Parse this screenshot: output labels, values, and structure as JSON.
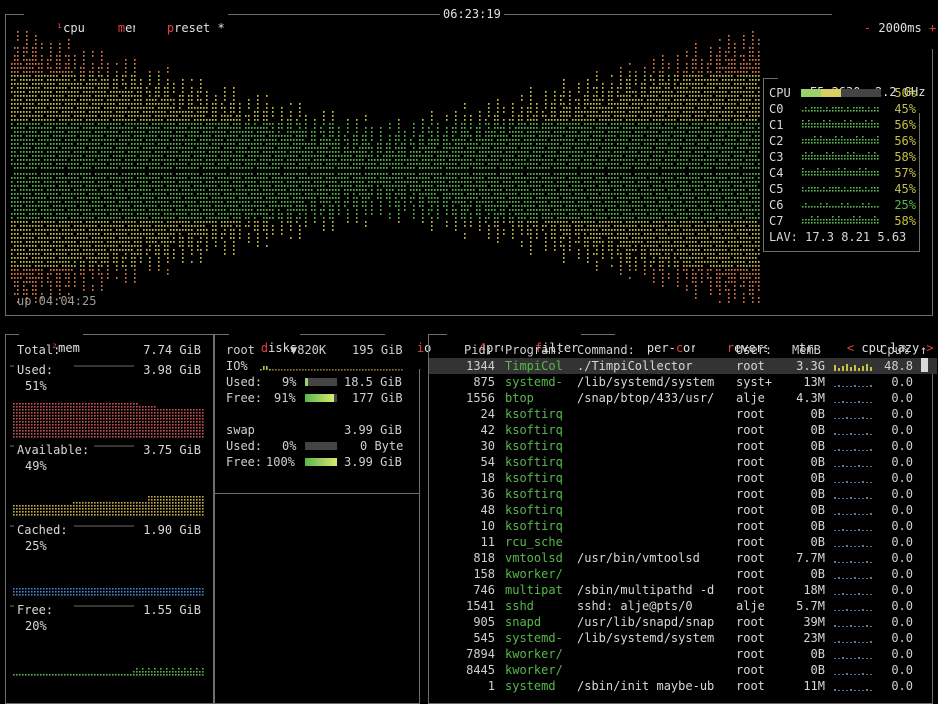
{
  "cpu_box": {
    "title_sup": "¹",
    "title_cpu": "cpu",
    "menu_hot": "m",
    "menu_rest": "enu",
    "preset_hot": "p",
    "preset_rest": "reset *",
    "clock": "06:23:19",
    "minus": "-",
    "interval": "2000ms",
    "plus": "+",
    "uptime": "up 04:04:25",
    "model": "E5-2630",
    "freq": "2.2 GHz",
    "total_label": "CPU",
    "total_percent": "50%",
    "total_level": 0.5,
    "cores": [
      {
        "label": "C0",
        "percent": "45%"
      },
      {
        "label": "C1",
        "percent": "56%"
      },
      {
        "label": "C2",
        "percent": "56%"
      },
      {
        "label": "C3",
        "percent": "58%"
      },
      {
        "label": "C4",
        "percent": "57%"
      },
      {
        "label": "C5",
        "percent": "45%"
      },
      {
        "label": "C6",
        "percent": "25%"
      },
      {
        "label": "C7",
        "percent": "58%"
      }
    ],
    "load_avg": "LAV: 17.3 8.21 5.63"
  },
  "mem_box": {
    "title_sup": "²",
    "title": "mem",
    "total_label": "Total:",
    "total_value": "7.74 GiB",
    "used_label": "Used:",
    "used_value": "3.98 GiB",
    "used_percent": "51%",
    "available_label": "Available:",
    "available_value": "3.75 GiB",
    "available_percent": "49%",
    "cached_label": "Cached:",
    "cached_value": "1.90 GiB",
    "cached_percent": "25%",
    "free_label": "Free:",
    "free_value": "1.55 GiB",
    "free_percent": "20%"
  },
  "disks_box": {
    "title_hot": "d",
    "title_rest": "isks",
    "io_hot": "i",
    "io_rest": "o",
    "root_name": "root",
    "root_io": "▼820K",
    "root_size": "195 GiB",
    "io_label": "IO%",
    "root_used_label": "Used:",
    "root_used_pct": "9%",
    "root_used_level": 0.09,
    "root_used_value": "18.5 GiB",
    "root_free_label": "Free:",
    "root_free_pct": "91%",
    "root_free_level": 0.91,
    "root_free_value": "177 GiB",
    "swap_name": "swap",
    "swap_size": "3.99 GiB",
    "swap_used_label": "Used:",
    "swap_used_pct": "0%",
    "swap_used_level": 0.0,
    "swap_used_value": "0 Byte",
    "swap_free_label": "Free:",
    "swap_free_pct": "100%",
    "swap_free_level": 1.0,
    "swap_free_value": "3.99 GiB"
  },
  "proc_box": {
    "title_sup": "4",
    "title": "proc",
    "filter_hot": "f",
    "filter_rest": "ilter",
    "percore_a": "per-",
    "percore_hot": "c",
    "percore_b": "ore",
    "reverse_hot": "r",
    "reverse_rest": "everse",
    "tree_a": "tr",
    "tree_hot": "e",
    "tree_b": "e",
    "left_arrow": "<",
    "sort_label": "cpu lazy",
    "right_arrow": ">",
    "headers": {
      "pid": "Pid:",
      "program": "Program:",
      "command": "Command:",
      "user": "User:",
      "mem": "MemB",
      "cpu": "Cpu%"
    },
    "scroll_up": "↑",
    "rows": [
      {
        "pid": "1344",
        "program": "TimpiCol",
        "command": "./TimpiCollector",
        "user": "root",
        "mem": "3.3G",
        "cpu": "48.8"
      },
      {
        "pid": "875",
        "program": "systemd-",
        "command": "/lib/systemd/system",
        "user": "syst+",
        "mem": "13M",
        "cpu": "0.0"
      },
      {
        "pid": "1556",
        "program": "btop",
        "command": "/snap/btop/433/usr/",
        "user": "alje",
        "mem": "4.3M",
        "cpu": "0.0"
      },
      {
        "pid": "24",
        "program": "ksoftirq",
        "command": "",
        "user": "root",
        "mem": "0B",
        "cpu": "0.0"
      },
      {
        "pid": "42",
        "program": "ksoftirq",
        "command": "",
        "user": "root",
        "mem": "0B",
        "cpu": "0.0"
      },
      {
        "pid": "30",
        "program": "ksoftirq",
        "command": "",
        "user": "root",
        "mem": "0B",
        "cpu": "0.0"
      },
      {
        "pid": "54",
        "program": "ksoftirq",
        "command": "",
        "user": "root",
        "mem": "0B",
        "cpu": "0.0"
      },
      {
        "pid": "18",
        "program": "ksoftirq",
        "command": "",
        "user": "root",
        "mem": "0B",
        "cpu": "0.0"
      },
      {
        "pid": "36",
        "program": "ksoftirq",
        "command": "",
        "user": "root",
        "mem": "0B",
        "cpu": "0.0"
      },
      {
        "pid": "48",
        "program": "ksoftirq",
        "command": "",
        "user": "root",
        "mem": "0B",
        "cpu": "0.0"
      },
      {
        "pid": "10",
        "program": "ksoftirq",
        "command": "",
        "user": "root",
        "mem": "0B",
        "cpu": "0.0"
      },
      {
        "pid": "11",
        "program": "rcu_sche",
        "command": "",
        "user": "root",
        "mem": "0B",
        "cpu": "0.0"
      },
      {
        "pid": "818",
        "program": "vmtoolsd",
        "command": "/usr/bin/vmtoolsd",
        "user": "root",
        "mem": "7.7M",
        "cpu": "0.0"
      },
      {
        "pid": "158",
        "program": "kworker/",
        "command": "",
        "user": "root",
        "mem": "0B",
        "cpu": "0.0"
      },
      {
        "pid": "746",
        "program": "multipat",
        "command": "/sbin/multipathd -d",
        "user": "root",
        "mem": "18M",
        "cpu": "0.0"
      },
      {
        "pid": "1541",
        "program": "sshd",
        "command": "sshd: alje@pts/0",
        "user": "alje",
        "mem": "5.7M",
        "cpu": "0.0"
      },
      {
        "pid": "905",
        "program": "snapd",
        "command": "/usr/lib/snapd/snap",
        "user": "root",
        "mem": "39M",
        "cpu": "0.0"
      },
      {
        "pid": "545",
        "program": "systemd-",
        "command": "/lib/systemd/system",
        "user": "root",
        "mem": "23M",
        "cpu": "0.0"
      },
      {
        "pid": "7894",
        "program": "kworker/",
        "command": "",
        "user": "root",
        "mem": "0B",
        "cpu": "0.0"
      },
      {
        "pid": "8445",
        "program": "kworker/",
        "command": "",
        "user": "root",
        "mem": "0B",
        "cpu": "0.0"
      },
      {
        "pid": "1",
        "program": "systemd",
        "command": "/sbin/init maybe-ub",
        "user": "root",
        "mem": "11M",
        "cpu": "0.0"
      }
    ]
  },
  "colors": {
    "low": "#58b84c",
    "mid": "#c8c040",
    "high": "#d87840",
    "mem_used": "#c85050",
    "mem_avail": "#c8b040",
    "mem_cached": "#4080c8",
    "mem_free": "#58b84c"
  }
}
